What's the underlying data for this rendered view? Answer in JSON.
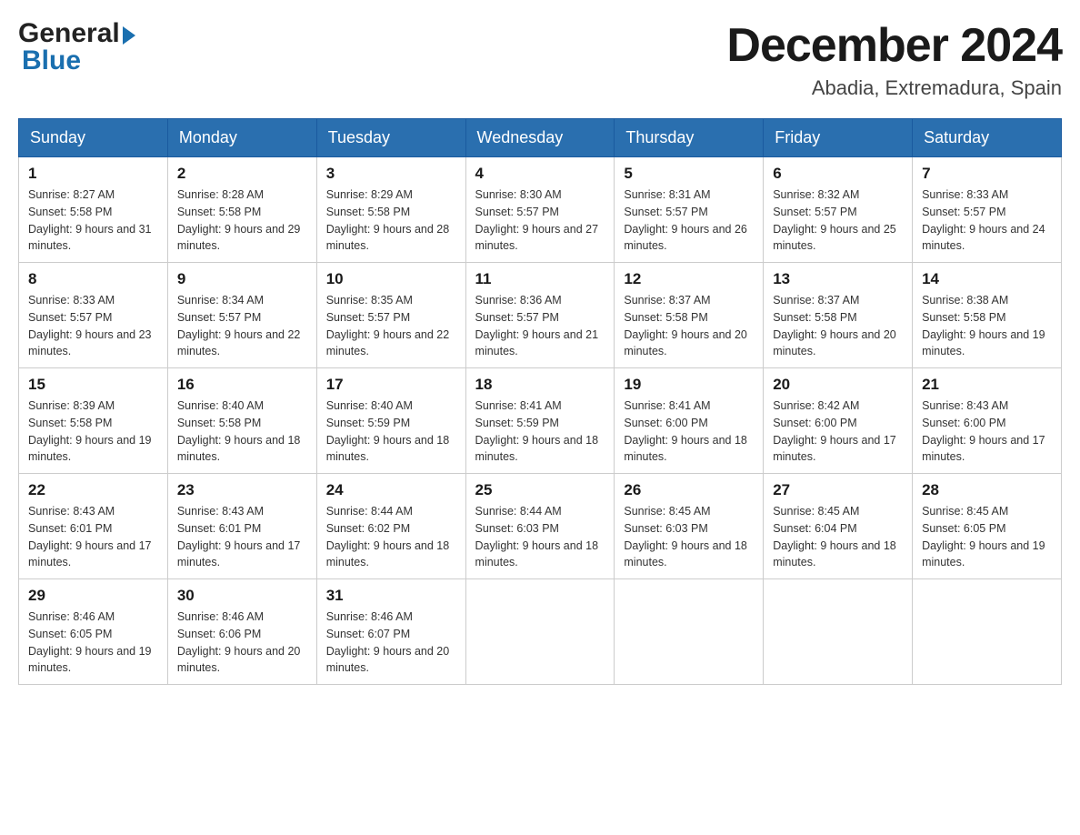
{
  "header": {
    "logo_general": "General",
    "logo_blue": "Blue",
    "month_title": "December 2024",
    "location": "Abadia, Extremadura, Spain"
  },
  "days_of_week": [
    "Sunday",
    "Monday",
    "Tuesday",
    "Wednesday",
    "Thursday",
    "Friday",
    "Saturday"
  ],
  "weeks": [
    [
      {
        "day": "1",
        "sunrise": "8:27 AM",
        "sunset": "5:58 PM",
        "daylight": "9 hours and 31 minutes."
      },
      {
        "day": "2",
        "sunrise": "8:28 AM",
        "sunset": "5:58 PM",
        "daylight": "9 hours and 29 minutes."
      },
      {
        "day": "3",
        "sunrise": "8:29 AM",
        "sunset": "5:58 PM",
        "daylight": "9 hours and 28 minutes."
      },
      {
        "day": "4",
        "sunrise": "8:30 AM",
        "sunset": "5:57 PM",
        "daylight": "9 hours and 27 minutes."
      },
      {
        "day": "5",
        "sunrise": "8:31 AM",
        "sunset": "5:57 PM",
        "daylight": "9 hours and 26 minutes."
      },
      {
        "day": "6",
        "sunrise": "8:32 AM",
        "sunset": "5:57 PM",
        "daylight": "9 hours and 25 minutes."
      },
      {
        "day": "7",
        "sunrise": "8:33 AM",
        "sunset": "5:57 PM",
        "daylight": "9 hours and 24 minutes."
      }
    ],
    [
      {
        "day": "8",
        "sunrise": "8:33 AM",
        "sunset": "5:57 PM",
        "daylight": "9 hours and 23 minutes."
      },
      {
        "day": "9",
        "sunrise": "8:34 AM",
        "sunset": "5:57 PM",
        "daylight": "9 hours and 22 minutes."
      },
      {
        "day": "10",
        "sunrise": "8:35 AM",
        "sunset": "5:57 PM",
        "daylight": "9 hours and 22 minutes."
      },
      {
        "day": "11",
        "sunrise": "8:36 AM",
        "sunset": "5:57 PM",
        "daylight": "9 hours and 21 minutes."
      },
      {
        "day": "12",
        "sunrise": "8:37 AM",
        "sunset": "5:58 PM",
        "daylight": "9 hours and 20 minutes."
      },
      {
        "day": "13",
        "sunrise": "8:37 AM",
        "sunset": "5:58 PM",
        "daylight": "9 hours and 20 minutes."
      },
      {
        "day": "14",
        "sunrise": "8:38 AM",
        "sunset": "5:58 PM",
        "daylight": "9 hours and 19 minutes."
      }
    ],
    [
      {
        "day": "15",
        "sunrise": "8:39 AM",
        "sunset": "5:58 PM",
        "daylight": "9 hours and 19 minutes."
      },
      {
        "day": "16",
        "sunrise": "8:40 AM",
        "sunset": "5:58 PM",
        "daylight": "9 hours and 18 minutes."
      },
      {
        "day": "17",
        "sunrise": "8:40 AM",
        "sunset": "5:59 PM",
        "daylight": "9 hours and 18 minutes."
      },
      {
        "day": "18",
        "sunrise": "8:41 AM",
        "sunset": "5:59 PM",
        "daylight": "9 hours and 18 minutes."
      },
      {
        "day": "19",
        "sunrise": "8:41 AM",
        "sunset": "6:00 PM",
        "daylight": "9 hours and 18 minutes."
      },
      {
        "day": "20",
        "sunrise": "8:42 AM",
        "sunset": "6:00 PM",
        "daylight": "9 hours and 17 minutes."
      },
      {
        "day": "21",
        "sunrise": "8:43 AM",
        "sunset": "6:00 PM",
        "daylight": "9 hours and 17 minutes."
      }
    ],
    [
      {
        "day": "22",
        "sunrise": "8:43 AM",
        "sunset": "6:01 PM",
        "daylight": "9 hours and 17 minutes."
      },
      {
        "day": "23",
        "sunrise": "8:43 AM",
        "sunset": "6:01 PM",
        "daylight": "9 hours and 17 minutes."
      },
      {
        "day": "24",
        "sunrise": "8:44 AM",
        "sunset": "6:02 PM",
        "daylight": "9 hours and 18 minutes."
      },
      {
        "day": "25",
        "sunrise": "8:44 AM",
        "sunset": "6:03 PM",
        "daylight": "9 hours and 18 minutes."
      },
      {
        "day": "26",
        "sunrise": "8:45 AM",
        "sunset": "6:03 PM",
        "daylight": "9 hours and 18 minutes."
      },
      {
        "day": "27",
        "sunrise": "8:45 AM",
        "sunset": "6:04 PM",
        "daylight": "9 hours and 18 minutes."
      },
      {
        "day": "28",
        "sunrise": "8:45 AM",
        "sunset": "6:05 PM",
        "daylight": "9 hours and 19 minutes."
      }
    ],
    [
      {
        "day": "29",
        "sunrise": "8:46 AM",
        "sunset": "6:05 PM",
        "daylight": "9 hours and 19 minutes."
      },
      {
        "day": "30",
        "sunrise": "8:46 AM",
        "sunset": "6:06 PM",
        "daylight": "9 hours and 20 minutes."
      },
      {
        "day": "31",
        "sunrise": "8:46 AM",
        "sunset": "6:07 PM",
        "daylight": "9 hours and 20 minutes."
      },
      null,
      null,
      null,
      null
    ]
  ]
}
